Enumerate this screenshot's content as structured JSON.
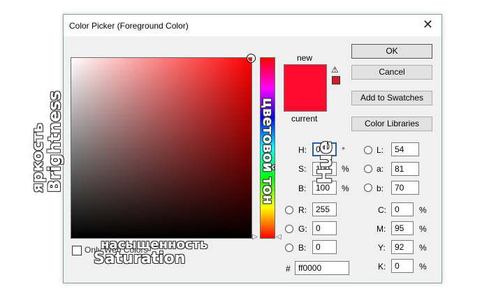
{
  "window": {
    "title": "Color Picker (Foreground Color)"
  },
  "icons": {
    "close": "close-icon",
    "warning": "warning-triangle-icon"
  },
  "preview": {
    "new_label": "new",
    "current_label": "current",
    "new_color": "#ff0a2f",
    "current_color": "#ff0a2f",
    "websafe_color": "#d61c2a"
  },
  "buttons": {
    "ok": "OK",
    "cancel": "Cancel",
    "add_to_swatches": "Add to Swatches",
    "color_libraries": "Color Libraries"
  },
  "hsb": {
    "h": {
      "label": "H:",
      "value": "0",
      "unit": "°"
    },
    "s": {
      "label": "S:",
      "value": "100",
      "unit": "%"
    },
    "b": {
      "label": "B:",
      "value": "100",
      "unit": "%"
    }
  },
  "rgb": {
    "r": {
      "label": "R:",
      "value": "255"
    },
    "g": {
      "label": "G:",
      "value": "0"
    },
    "b": {
      "label": "B:",
      "value": "0"
    }
  },
  "lab": {
    "l": {
      "label": "L:",
      "value": "54"
    },
    "a": {
      "label": "a:",
      "value": "81"
    },
    "b": {
      "label": "b:",
      "value": "70"
    }
  },
  "cmyk": {
    "c": {
      "label": "C:",
      "value": "0",
      "unit": "%"
    },
    "m": {
      "label": "M:",
      "value": "95",
      "unit": "%"
    },
    "y": {
      "label": "Y:",
      "value": "92",
      "unit": "%"
    },
    "k": {
      "label": "K:",
      "value": "0",
      "unit": "%"
    }
  },
  "hex": {
    "label": "#",
    "value": "ff0000"
  },
  "only_web_colors": {
    "label": "Only Web Colors",
    "checked": false
  },
  "annotations": {
    "brightness_ru": "яркость",
    "brightness_en": "Brightness",
    "hue_ru": "цветовой тон",
    "hue_en": "Hue",
    "saturation_ru": "насыщенность",
    "saturation_en": "Saturation"
  }
}
